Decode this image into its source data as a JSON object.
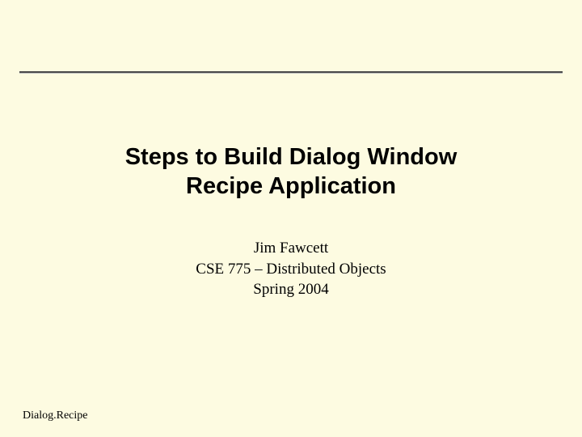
{
  "title": {
    "line1": "Steps to Build Dialog Window",
    "line2": "Recipe Application"
  },
  "subtitle": {
    "author": "Jim Fawcett",
    "course": "CSE 775 – Distributed Objects",
    "term": "Spring 2004"
  },
  "footer": {
    "label": "Dialog.Recipe"
  }
}
